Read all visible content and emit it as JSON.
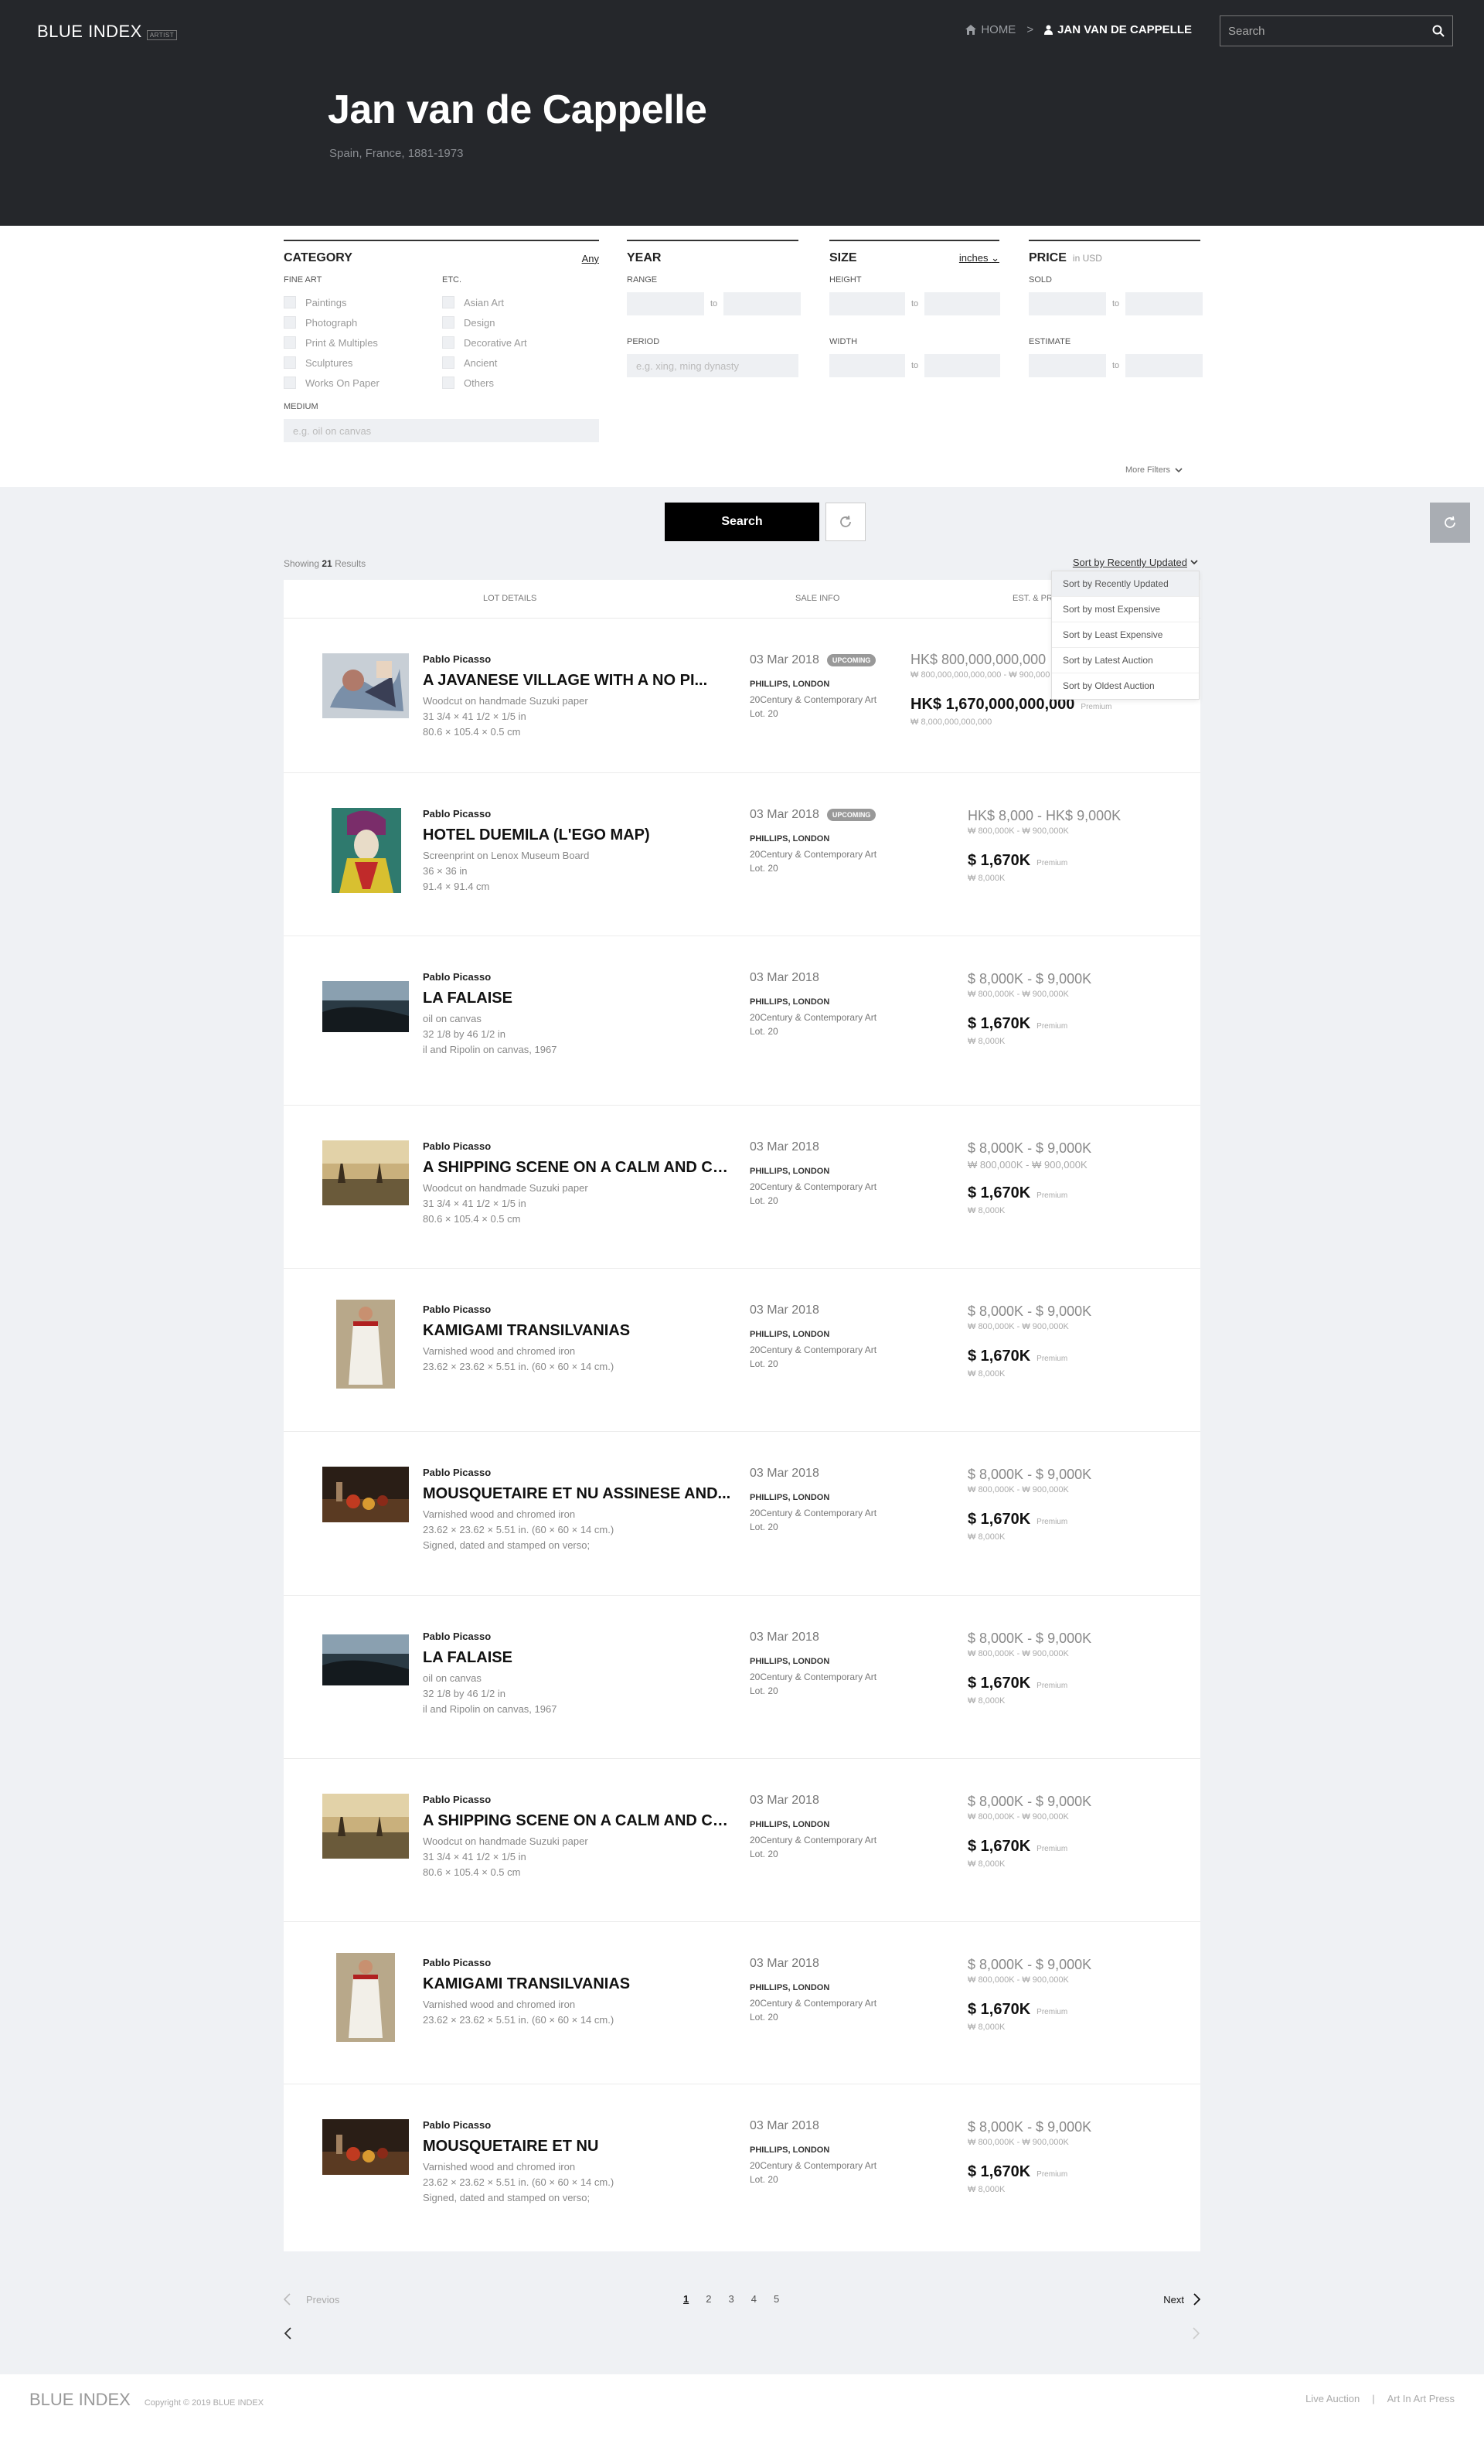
{
  "header": {
    "logo": "BLUE INDEX",
    "logo_tag": "ARTIST",
    "breadcrumb_home": "HOME",
    "breadcrumb_sep": ">",
    "breadcrumb_current": "JAN VAN DE CAPPELLE",
    "search_placeholder": "Search"
  },
  "artist": {
    "name": "Jan van de Cappelle",
    "meta": "Spain, France, 1881-1973"
  },
  "filters": {
    "category": {
      "title": "CATEGORY",
      "side": "Any",
      "fine_art_label": "FINE ART",
      "fine_art": [
        "Paintings",
        "Photograph",
        "Print & Multiples",
        "Sculptures",
        "Works On Paper"
      ],
      "etc_label": "ETC.",
      "etc": [
        "Asian Art",
        "Design",
        "Decorative Art",
        "Ancient",
        "Others"
      ],
      "medium_label": "MEDIUM",
      "medium_placeholder": "e.g. oil on canvas"
    },
    "year": {
      "title": "YEAR",
      "range_label": "RANGE",
      "to": "to",
      "period_label": "PERIOD",
      "period_placeholder": "e.g. xing, ming dynasty"
    },
    "size": {
      "title": "SIZE",
      "side": "inches",
      "height_label": "HEIGHT",
      "width_label": "WIDTH",
      "to": "to"
    },
    "price": {
      "title": "PRICE",
      "unit": "in USD",
      "sold_label": "SOLD",
      "estimate_label": "ESTIMATE",
      "to": "to"
    },
    "more_filters": "More Filters"
  },
  "actions": {
    "search_button": "Search"
  },
  "results_meta": {
    "showing_prefix": "Showing",
    "count": "21",
    "showing_suffix": "Results",
    "sort_label": "Sort by Recently Updated",
    "sort_options": [
      "Sort by Recently Updated",
      "Sort by most Expensive",
      "Sort by Least Expensive",
      "Sort by Latest Auction",
      "Sort by Oldest Auction"
    ]
  },
  "table_headers": {
    "lot_details": "LOT DETAILS",
    "sale_info": "SALE INFO",
    "estimate": "EST. & PRICE"
  },
  "lots": [
    {
      "artist": "Pablo Picasso",
      "title": "A JAVANESE VILLAGE WITH A NO PI...",
      "desc": [
        "Woodcut on handmade Suzuki paper",
        "31 3/4 × 41 1/2 × 1/5 in",
        "80.6 × 105.4 × 0.5 cm"
      ],
      "date": "03 Mar 2018",
      "badge": "UPCOMING",
      "house": "PHILLIPS, LONDON",
      "sale": [
        "20Century & Contemporary Art",
        "Lot. 20"
      ],
      "estimate": "HK$ 800,000,000,000 - HK$ 900,000,000,000",
      "estimate_sub": "₩ 800,000,000,000,000 - ₩ 900,000,000,000,000",
      "premium": "HK$ 1,670,000,000,000",
      "premium_label": "Premium",
      "premium_sub": "₩ 8,000,000,000,000"
    },
    {
      "artist": "Pablo Picasso",
      "title": "HOTEL DUEMILA (L'EGO MAP)",
      "desc": [
        "Screenprint on Lenox Museum Board",
        "36 × 36 in",
        "91.4 × 91.4 cm"
      ],
      "date": "03 Mar 2018",
      "badge": "UPCOMING",
      "house": "PHILLIPS, LONDON",
      "sale": [
        "20Century & Contemporary Art",
        "Lot. 20"
      ],
      "estimate": "HK$ 8,000 - HK$ 9,000K",
      "estimate_sub": "₩ 800,000K - ₩ 900,000K",
      "premium": "$ 1,670K",
      "premium_label": "Premium",
      "premium_sub": "₩ 8,000K"
    },
    {
      "artist": "Pablo Picasso",
      "title": "LA FALAISE",
      "desc": [
        "oil on canvas",
        "32 1/8 by 46 1/2 in",
        "il and Ripolin on canvas, 1967"
      ],
      "date": "03 Mar 2018",
      "badge": "",
      "house": "PHILLIPS, LONDON",
      "sale": [
        "20Century & Contemporary Art",
        "Lot. 20"
      ],
      "estimate": "$ 8,000K - $ 9,000K",
      "estimate_sub": "₩ 800,000K - ₩ 900,000K",
      "premium": "$ 1,670K",
      "premium_label": "Premium",
      "premium_sub": "₩ 8,000K"
    },
    {
      "artist": "Pablo Picasso",
      "title": "A SHIPPING SCENE ON A CALM AND CA...",
      "desc": [
        "Woodcut on handmade Suzuki paper",
        "31 3/4 × 41 1/2 × 1/5 in",
        "80.6 × 105.4 × 0.5 cm"
      ],
      "date": "03 Mar 2018",
      "badge": "",
      "house": "PHILLIPS, LONDON",
      "sale": [
        "20Century & Contemporary Art",
        "Lot. 20"
      ],
      "estimate": "$ 8,000K - $ 9,000K",
      "estimate_sub": "₩ 800,000K - ₩ 900,000K",
      "premium": "$ 1,670K",
      "premium_label": "Premium",
      "premium_sub": "₩ 8,000K"
    },
    {
      "artist": "Pablo Picasso",
      "title": "KAMIGAMI TRANSILVANIAS",
      "desc": [
        "Varnished wood and chromed iron",
        "23.62 × 23.62 × 5.51 in. (60 × 60 × 14 cm.)"
      ],
      "date": "03 Mar 2018",
      "badge": "",
      "house": "PHILLIPS, LONDON",
      "sale": [
        "20Century & Contemporary Art",
        "Lot. 20"
      ],
      "estimate": "$ 8,000K - $ 9,000K",
      "estimate_sub": "₩ 800,000K - ₩ 900,000K",
      "premium": "$ 1,670K",
      "premium_label": "Premium",
      "premium_sub": "₩ 8,000K"
    },
    {
      "artist": "Pablo Picasso",
      "title": "MOUSQUETAIRE ET NU ASSINESE AND...",
      "desc": [
        "Varnished wood and chromed iron",
        "23.62 × 23.62 × 5.51 in. (60 × 60 × 14 cm.)",
        "Signed, dated and stamped on verso;"
      ],
      "date": "03 Mar 2018",
      "badge": "",
      "house": "PHILLIPS, LONDON",
      "sale": [
        "20Century & Contemporary Art",
        "Lot. 20"
      ],
      "estimate": "$ 8,000K - $ 9,000K",
      "estimate_sub": "₩ 800,000K - ₩ 900,000K",
      "premium": "$ 1,670K",
      "premium_label": "Premium",
      "premium_sub": "₩ 8,000K"
    },
    {
      "artist": "Pablo Picasso",
      "title": "LA FALAISE",
      "desc": [
        "oil on canvas",
        "32 1/8 by 46 1/2 in",
        "il and Ripolin on canvas, 1967"
      ],
      "date": "03 Mar 2018",
      "badge": "",
      "house": "PHILLIPS, LONDON",
      "sale": [
        "20Century & Contemporary Art",
        "Lot. 20"
      ],
      "estimate": "$ 8,000K - $ 9,000K",
      "estimate_sub": "₩ 800,000K - ₩ 900,000K",
      "premium": "$ 1,670K",
      "premium_label": "Premium",
      "premium_sub": "₩ 8,000K"
    },
    {
      "artist": "Pablo Picasso",
      "title": "A SHIPPING SCENE ON A CALM AND CA...",
      "desc": [
        "Woodcut on handmade Suzuki paper",
        "31 3/4 × 41 1/2 × 1/5 in",
        "80.6 × 105.4 × 0.5 cm"
      ],
      "date": "03 Mar 2018",
      "badge": "",
      "house": "PHILLIPS, LONDON",
      "sale": [
        "20Century & Contemporary Art",
        "Lot. 20"
      ],
      "estimate": "$ 8,000K - $ 9,000K",
      "estimate_sub": "₩ 800,000K - ₩ 900,000K",
      "premium": "$ 1,670K",
      "premium_label": "Premium",
      "premium_sub": "₩ 8,000K"
    },
    {
      "artist": "Pablo Picasso",
      "title": "KAMIGAMI TRANSILVANIAS",
      "desc": [
        "Varnished wood and chromed iron",
        "23.62 × 23.62 × 5.51 in. (60 × 60 × 14 cm.)"
      ],
      "date": "03 Mar 2018",
      "badge": "",
      "house": "PHILLIPS, LONDON",
      "sale": [
        "20Century & Contemporary Art",
        "Lot. 20"
      ],
      "estimate": "$ 8,000K - $ 9,000K",
      "estimate_sub": "₩ 800,000K - ₩ 900,000K",
      "premium": "$ 1,670K",
      "premium_label": "Premium",
      "premium_sub": "₩ 8,000K"
    },
    {
      "artist": "Pablo Picasso",
      "title": "MOUSQUETAIRE ET NU",
      "desc": [
        "Varnished wood and chromed iron",
        "23.62 × 23.62 × 5.51 in. (60 × 60 × 14 cm.)",
        "Signed, dated and stamped on verso;"
      ],
      "date": "03 Mar 2018",
      "badge": "",
      "house": "PHILLIPS, LONDON",
      "sale": [
        "20Century & Contemporary Art",
        "Lot. 20"
      ],
      "estimate": "$ 8,000K - $ 9,000K",
      "estimate_sub": "₩ 800,000K - ₩ 900,000K",
      "premium": "$ 1,670K",
      "premium_label": "Premium",
      "premium_sub": "₩ 8,000K"
    }
  ],
  "pagination": {
    "prev": "Previos",
    "pages": [
      "1",
      "2",
      "3",
      "4",
      "5"
    ],
    "next": "Next"
  },
  "footer": {
    "logo": "BLUE INDEX",
    "copyright": "Copyright © 2019 BLUE INDEX",
    "links": [
      "Live Auction",
      "|",
      "Art In Art Press"
    ]
  }
}
